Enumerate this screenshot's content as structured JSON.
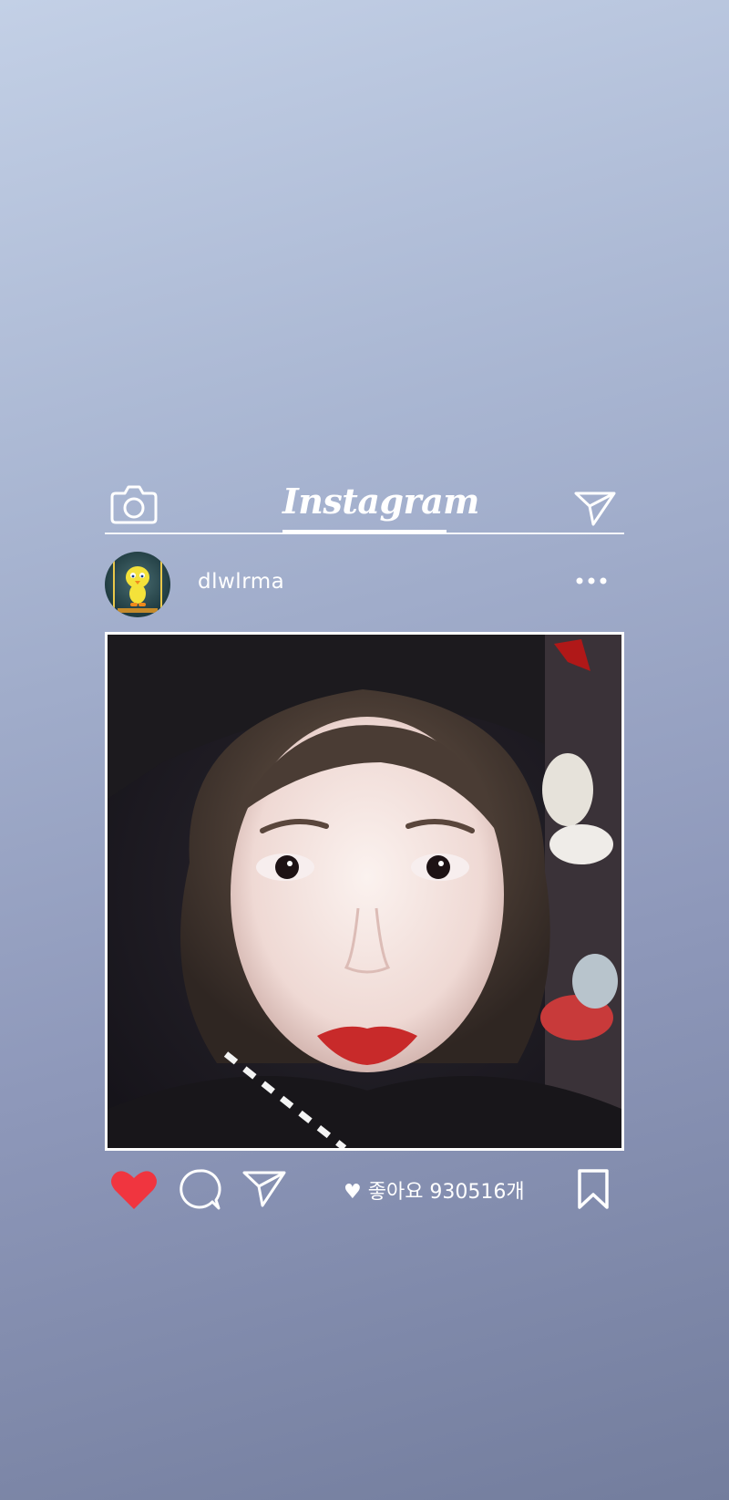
{
  "app": {
    "name": "Instagram"
  },
  "post": {
    "username": "dlwlrma",
    "likes_text": "♥ 좋아요 930516개",
    "liked": true
  },
  "icons": {
    "camera": "camera-icon",
    "direct": "paper-plane-icon",
    "more": "more-dots-icon",
    "heart": "heart-icon",
    "comment": "comment-icon",
    "share": "paper-plane-icon",
    "bookmark": "bookmark-icon"
  },
  "colors": {
    "heart": "#f0353f",
    "foreground": "#ffffff",
    "bg_top": "#c3d0e6",
    "bg_bottom": "#737d9d"
  }
}
